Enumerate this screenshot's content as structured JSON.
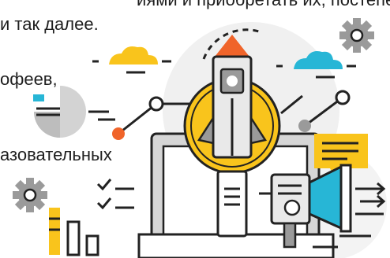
{
  "text_lines": [
    "иями и приобретать их, постепенн",
    "и так далее.",
    "офеев,",
    "азовательных"
  ],
  "colors": {
    "text": "#1f1f1f",
    "outline": "#222222",
    "orange": "#f0642a",
    "yellow": "#f9c41c",
    "blue": "#27b6d6",
    "gray": "#bdbdbd",
    "light_gray": "#efefef"
  },
  "icons": [
    "rocket-icon",
    "magnifier-icon",
    "laptop-icon",
    "pie-chart-icon",
    "gear-icon",
    "cloud-icon",
    "megaphone-icon",
    "bar-chart-icon",
    "checklist-icon",
    "chat-bubble-icon"
  ]
}
